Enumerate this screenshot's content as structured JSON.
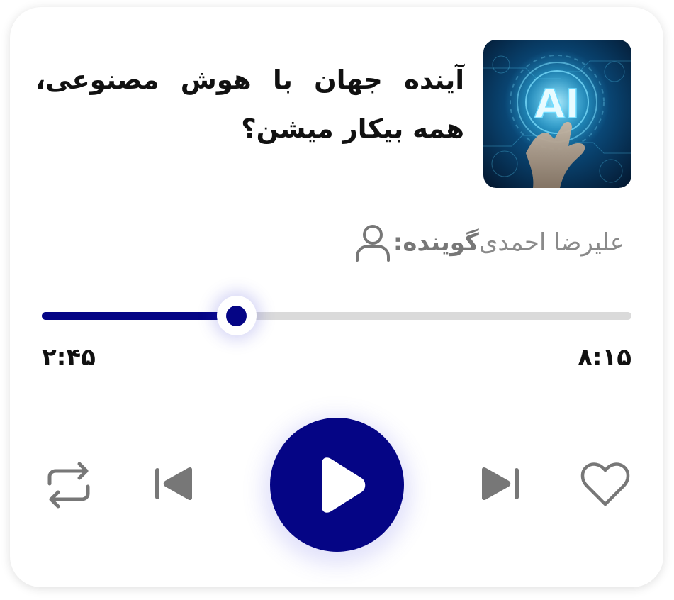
{
  "episode": {
    "title": "آینده جهان با هوش مصنوعی، همه بیکار میشن؟",
    "cover_art_text": "AI"
  },
  "narrator": {
    "label": "گوینده:",
    "name": "علیرضا احمدی",
    "icon": "person-icon"
  },
  "progress": {
    "elapsed": "۲:۴۵",
    "total": "۸:۱۵",
    "fraction": 0.33
  },
  "controls": {
    "repeat": "repeat-icon",
    "previous": "skip-previous-icon",
    "play": "play-icon",
    "next": "skip-next-icon",
    "favorite": "heart-icon"
  },
  "colors": {
    "accent": "#050585",
    "track": "#dadada",
    "icon_gray": "#777777"
  }
}
